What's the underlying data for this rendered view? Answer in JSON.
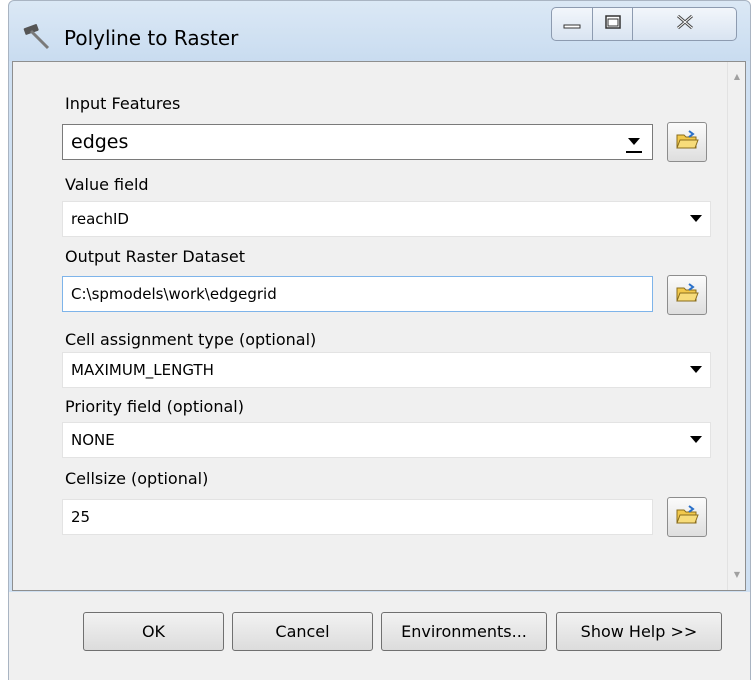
{
  "window": {
    "title": "Polyline to Raster",
    "icon": "hammer-icon"
  },
  "controls": {
    "minimize": "minimize-icon",
    "maximize": "maximize-icon",
    "close": "close-icon"
  },
  "form": {
    "input_features": {
      "label": "Input Features",
      "value": "edges"
    },
    "value_field": {
      "label": "Value field",
      "value": "reachID"
    },
    "output_raster": {
      "label": "Output Raster Dataset",
      "value": "C:\\spmodels\\work\\edgegrid"
    },
    "cell_assignment": {
      "label": "Cell assignment type (optional)",
      "value": "MAXIMUM_LENGTH"
    },
    "priority_field": {
      "label": "Priority field (optional)",
      "value": "NONE"
    },
    "cellsize": {
      "label": "Cellsize (optional)",
      "value": "25"
    }
  },
  "buttons": {
    "ok": "OK",
    "cancel": "Cancel",
    "environments": "Environments...",
    "show_help": "Show Help >>"
  },
  "colors": {
    "title_bg": "#cfe0f2",
    "panel_bg": "#f0f0f0",
    "folder_yellow": "#f2c94c"
  }
}
